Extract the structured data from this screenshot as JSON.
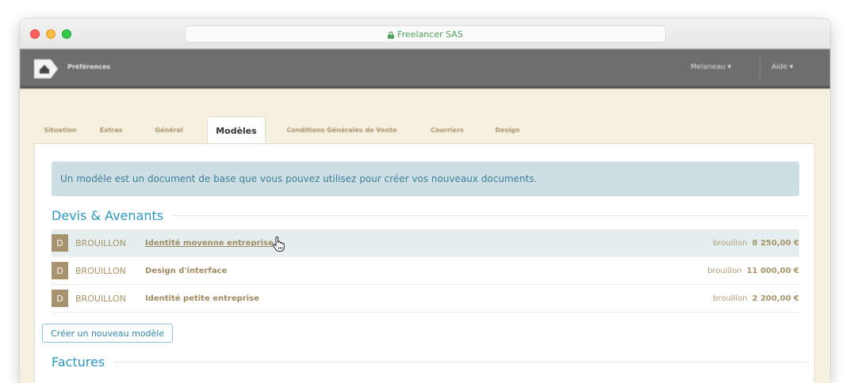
{
  "browser": {
    "url": "Freelancer SAS"
  },
  "header": {
    "app_title": "Préférences",
    "user_menu": "Melaneau ▾",
    "help_menu": "Aide ▾"
  },
  "tabs": [
    {
      "label": "Situation",
      "active": false
    },
    {
      "label": "Extras",
      "active": false
    },
    {
      "label": "Général",
      "active": false
    },
    {
      "label": "Modèles",
      "active": true
    },
    {
      "label": "Conditions Générales de Vente",
      "active": false
    },
    {
      "label": "Courriers",
      "active": false
    },
    {
      "label": "Design",
      "active": false
    }
  ],
  "info_message": "Un modèle est un document de base que vous pouvez utilisez pour créer vos nouveaux documents.",
  "sections": {
    "devis": {
      "title": "Devis & Avenants",
      "rows": [
        {
          "badge": "D",
          "status": "BROUILLON",
          "name": "Identité moyenne entreprise",
          "state": "brouillon",
          "amount": "8 250,00 €"
        },
        {
          "badge": "D",
          "status": "BROUILLON",
          "name": "Design d'interface",
          "state": "brouillon",
          "amount": "11 000,00 €"
        },
        {
          "badge": "D",
          "status": "BROUILLON",
          "name": "Identité petite entreprise",
          "state": "brouillon",
          "amount": "2 200,00 €"
        }
      ],
      "create_label": "Créer un nouveau modèle"
    },
    "factures": {
      "title": "Factures"
    }
  },
  "colors": {
    "accent": "#2b97c6",
    "badge": "#a8916d",
    "header": "#6e6e6e",
    "background": "#f6f0e1"
  }
}
